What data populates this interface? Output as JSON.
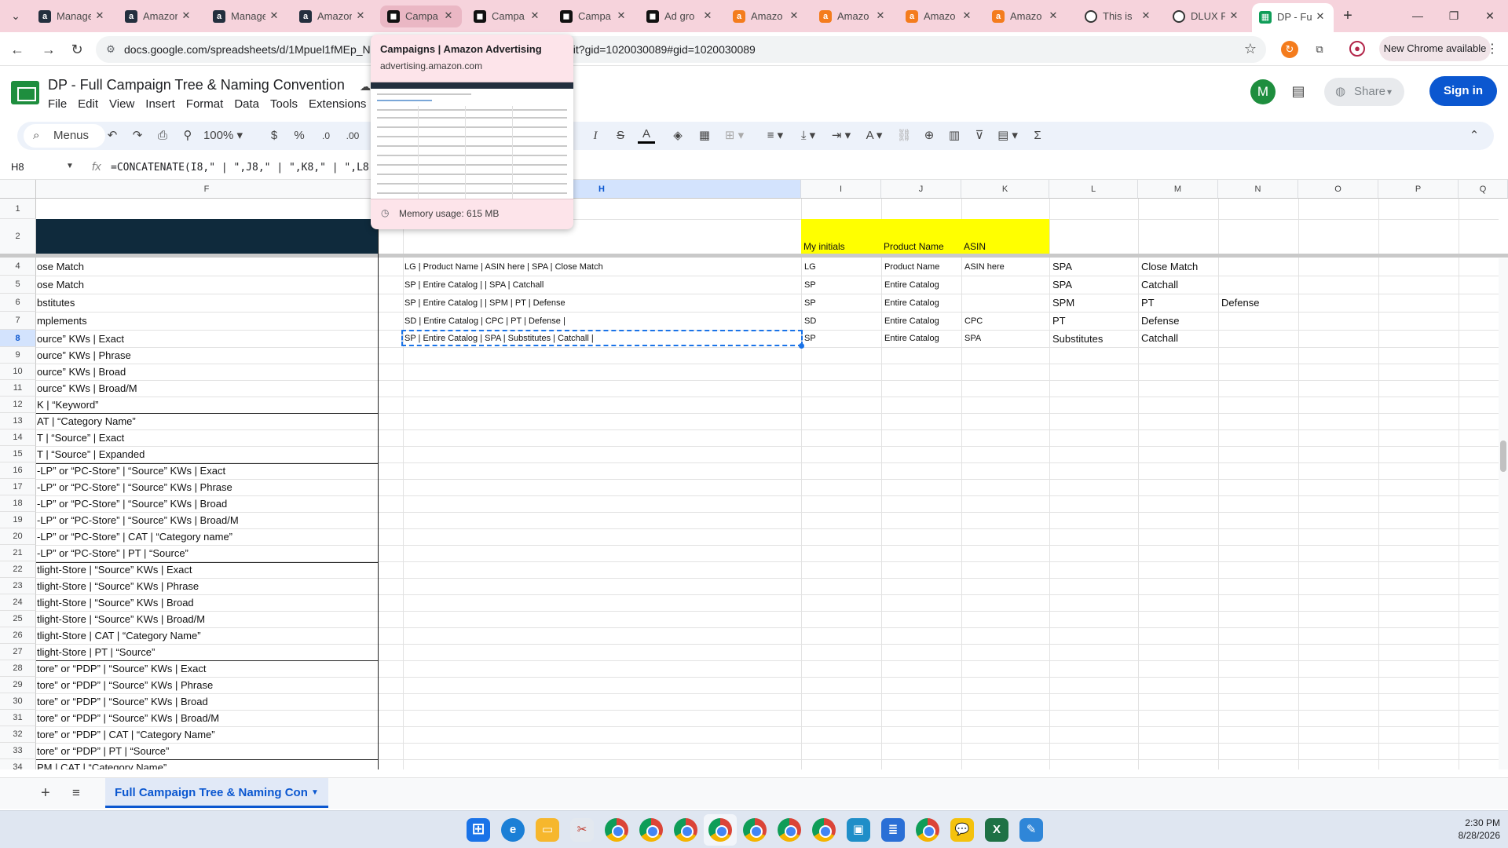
{
  "browser": {
    "tabs": [
      {
        "label": "Manage",
        "icon": "amazon-icon"
      },
      {
        "label": "Amazon",
        "icon": "amazon-icon"
      },
      {
        "label": "Manage",
        "icon": "amazon-icon"
      },
      {
        "label": "Amazon",
        "icon": "amazon-icon"
      },
      {
        "label": "Campa",
        "icon": "amazon-ads-icon"
      },
      {
        "label": "Campa",
        "icon": "amazon-ads-icon"
      },
      {
        "label": "Campa",
        "icon": "amazon-ads-icon"
      },
      {
        "label": "Ad gro",
        "icon": "amazon-ads-icon"
      },
      {
        "label": "Amazo",
        "icon": "amazon-orange-icon"
      },
      {
        "label": "Amazo",
        "icon": "amazon-orange-icon"
      },
      {
        "label": "Amazo",
        "icon": "amazon-orange-icon"
      },
      {
        "label": "Amazo",
        "icon": "amazon-orange-icon"
      },
      {
        "label": "This is",
        "icon": "circle-icon"
      },
      {
        "label": "DLUX F",
        "icon": "circle-icon"
      },
      {
        "label": "DP - Fu",
        "icon": "sheets-icon"
      }
    ],
    "url": "docs.google.com/spreadsheets/d/1Mpuel1fMEp_N",
    "url_tail": "dit?gid=1020030089#gid=1020030089",
    "new_chrome": "New Chrome available",
    "hover_card": {
      "title": "Campaigns | Amazon Advertising",
      "url": "advertising.amazon.com",
      "memory": "Memory usage: 615 MB"
    }
  },
  "sheets": {
    "doc_title": "DP - Full Campaign Tree & Naming Convention",
    "menu": [
      "File",
      "Edit",
      "View",
      "Insert",
      "Format",
      "Data",
      "Tools",
      "Extensions"
    ],
    "share_label": "Share",
    "signin_label": "Sign in",
    "avatar_letter": "M",
    "toolbar": {
      "menus_label": "Menus",
      "zoom": "100%",
      "currency": "$",
      "percent": "%",
      "dec_decrease": ".0",
      "dec_increase": ".00"
    },
    "namebox": "H8",
    "formula": "=CONCATENATE(I8,\" | \",J8,\" | \",K8,\" | \",L8,\" |",
    "columns": [
      "F",
      "H",
      "I",
      "J",
      "K",
      "L",
      "M",
      "N",
      "O",
      "P",
      "Q"
    ],
    "rows": [
      "1",
      "2",
      "4",
      "5",
      "6",
      "7",
      "8",
      "9",
      "10",
      "11",
      "12",
      "13",
      "14",
      "15",
      "16",
      "17",
      "18",
      "19",
      "20",
      "21",
      "22",
      "23",
      "24",
      "25",
      "26",
      "27",
      "28",
      "29",
      "30",
      "31",
      "32",
      "33",
      "34"
    ],
    "headers_row2": {
      "I": "My initials",
      "J": "Product Name",
      "K": "ASIN"
    },
    "col_f": [
      "ose Match",
      "ose Match",
      "bstitutes",
      "mplements",
      "ource” KWs | Exact",
      "ource” KWs | Phrase",
      "ource” KWs | Broad",
      "ource” KWs | Broad/M",
      "K | “Keyword”",
      "AT | “Category Name”",
      "T | “Source” | Exact",
      "T | “Source” | Expanded",
      "-LP” or “PC-Store” | “Source” KWs | Exact",
      "-LP” or “PC-Store” | “Source” KWs | Phrase",
      "-LP” or “PC-Store” | “Source” KWs | Broad",
      "-LP” or “PC-Store” | “Source” KWs | Broad/M",
      "-LP” or “PC-Store” | CAT | “Category name”",
      "-LP” or “PC-Store” | PT | “Source”",
      "tlight-Store | “Source” KWs | Exact",
      "tlight-Store | “Source” KWs | Phrase",
      "tlight-Store | “Source” KWs | Broad",
      "tlight-Store | “Source” KWs | Broad/M",
      "tlight-Store | CAT | “Category Name”",
      "tlight-Store | PT | “Source”",
      "tore” or “PDP” | “Source” KWs | Exact",
      "tore” or “PDP” | “Source” KWs | Phrase",
      "tore” or “PDP” | “Source” KWs | Broad",
      "tore” or “PDP” | “Source” KWs | Broad/M",
      "tore” or “PDP” | CAT | “Category Name”",
      "tore” or “PDP” | PT | “Source”",
      "PM | CAT | “Category Name”"
    ],
    "data_rows": [
      {
        "H": "LG | Product Name | ASIN here | SPA | Close Match",
        "I": "LG",
        "J": "Product Name",
        "K": "ASIN here",
        "L": "SPA",
        "M": "Close Match",
        "N": ""
      },
      {
        "H": "SP | Entire Catalog |  | SPA | Catchall",
        "I": "SP",
        "J": "Entire Catalog",
        "K": "",
        "L": "SPA",
        "M": "Catchall",
        "N": ""
      },
      {
        "H": "SP | Entire Catalog |  | SPM | PT | Defense",
        "I": "SP",
        "J": "Entire Catalog",
        "K": "",
        "L": "SPM",
        "M": "PT",
        "N": "Defense"
      },
      {
        "H": "SD | Entire Catalog | CPC | PT | Defense |",
        "I": "SD",
        "J": "Entire Catalog",
        "K": "CPC",
        "L": "PT",
        "M": "Defense",
        "N": ""
      },
      {
        "H": "SP | Entire Catalog | SPA | Substitutes | Catchall |",
        "I": "SP",
        "J": "Entire Catalog",
        "K": "SPA",
        "L": "Substitutes",
        "M": "Catchall",
        "N": ""
      }
    ],
    "sheet_tab": "Full Campaign Tree & Naming Con"
  },
  "taskbar": {
    "time": "2:30 PM",
    "date": "8/28/2026"
  },
  "colors": {
    "accent": "#0b57d0",
    "tab_strip": "#f6d3dc",
    "yellow_header": "#ffff00",
    "dark_band": "#0f2a3c"
  }
}
